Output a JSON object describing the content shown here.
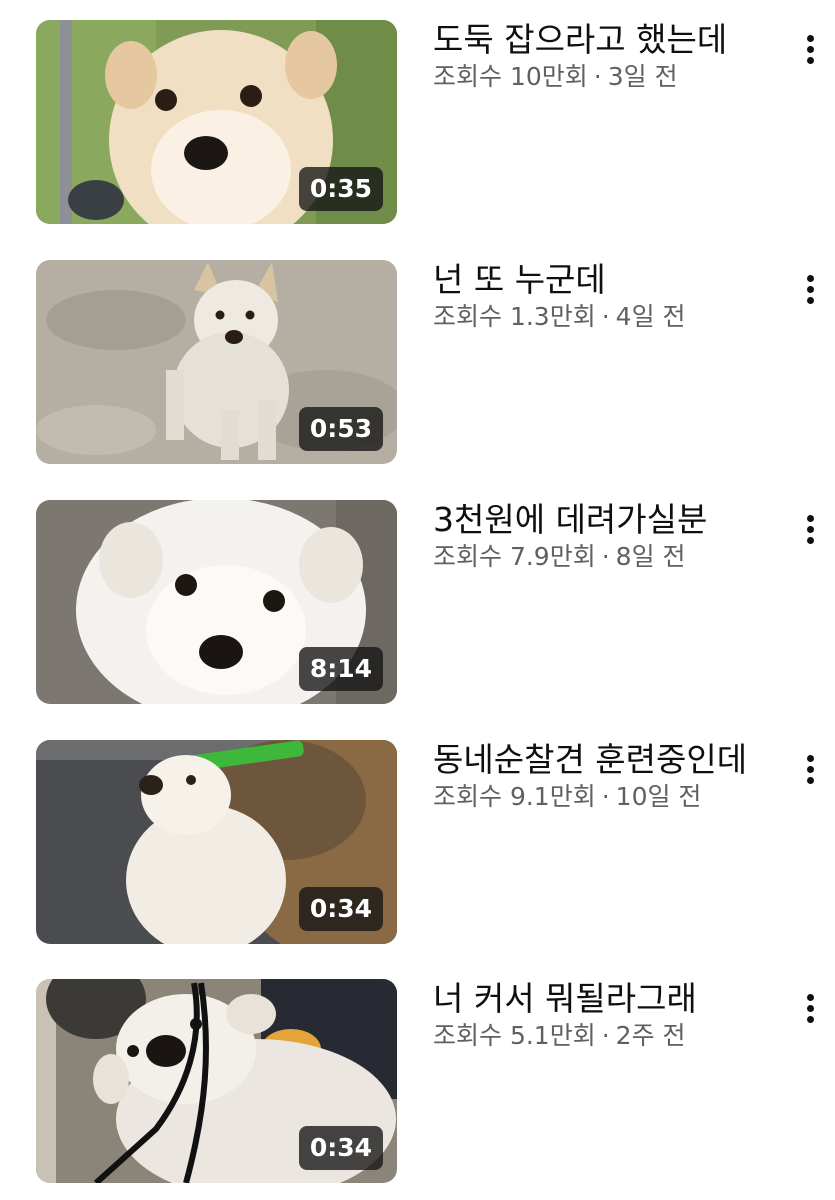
{
  "videos": [
    {
      "title": "도둑 잡으라고 했는데",
      "views": "조회수 10만회",
      "separator": "·",
      "age": "3일 전",
      "duration": "0:35",
      "thumbnail_icon": "white-puppy-closeup-thumbnail"
    },
    {
      "title": "넌 또 누군데",
      "views": "조회수 1.3만회",
      "separator": "·",
      "age": "4일 전",
      "duration": "0:53",
      "thumbnail_icon": "white-jindo-dog-standing-thumbnail"
    },
    {
      "title": "3천원에 데려가실분",
      "views": "조회수 7.9만회",
      "separator": "·",
      "age": "8일 전",
      "duration": "8:14",
      "thumbnail_icon": "fluffy-white-puppy-thumbnail"
    },
    {
      "title": "동네순찰견 훈련중인데",
      "views": "조회수 9.1만회",
      "separator": "·",
      "age": "10일 전",
      "duration": "0:34",
      "thumbnail_icon": "puppy-with-green-collar-thumbnail"
    },
    {
      "title": "너 커서 뭐될라그래",
      "views": "조회수 5.1만회",
      "separator": "·",
      "age": "2주 전",
      "duration": "0:34",
      "thumbnail_icon": "puppy-biting-leash-thumbnail"
    }
  ],
  "colors": {
    "title": "#0f0f0f",
    "subtitle": "#606060",
    "duration_bg": "#141414",
    "duration_text": "#ffffff"
  }
}
